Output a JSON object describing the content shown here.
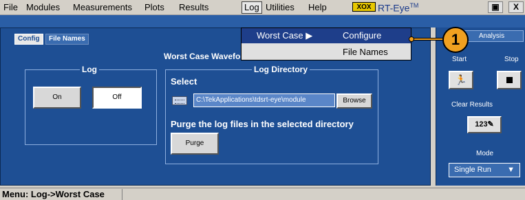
{
  "menubar": {
    "items": [
      "File",
      "Modules",
      "Measurements",
      "Plots",
      "Results",
      "Log",
      "Utilities",
      "Help"
    ],
    "logo": "XOX",
    "app_title": "RT-Eye",
    "app_title_tm": "TM",
    "minimize_label": "▣",
    "close_label": "X"
  },
  "tabs": {
    "config": "Config",
    "file_names": "File Names",
    "analysis": "Analysis"
  },
  "main": {
    "section_title": "Worst Case Waveforms",
    "log_group_label": "Log",
    "on_label": "On",
    "off_label": "Off",
    "log_dir_label": "Log Directory",
    "select_label": "Select",
    "path_value": "C:\\TekApplications\\tdsrt-eye\\module",
    "browse_label": "Browse",
    "purge_text": "Purge the log files in the selected directory",
    "purge_label": "Purge"
  },
  "right_panel": {
    "start_label": "Start",
    "stop_label": "Stop",
    "start_icon": "running-figure",
    "stop_icon": "stop-square",
    "clear_results_label": "Clear Results",
    "clear_icon": "123-eraser",
    "mode_label": "Mode",
    "mode_value": "Single Run"
  },
  "dropdown": {
    "worst_case": "Worst Case",
    "configure": "Configure",
    "file_names": "File Names"
  },
  "callout": {
    "number": "1"
  },
  "status": {
    "text": "Menu: Log->Worst Case"
  },
  "colors": {
    "panel": "#1e4f94",
    "highlight": "#1e3e8a",
    "callout": "#f0a020"
  }
}
